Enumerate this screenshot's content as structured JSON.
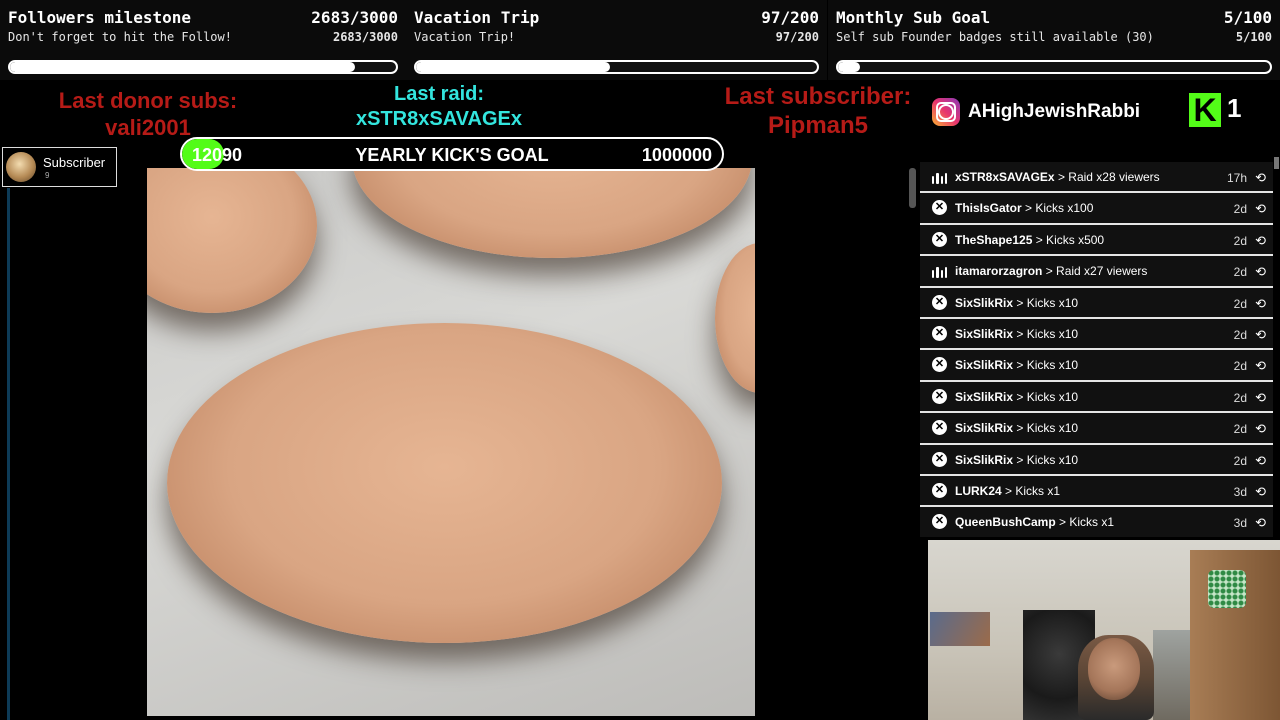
{
  "goals": [
    {
      "title": "Followers milestone",
      "count": "2683/3000",
      "subtitle": "Don't forget to hit the Follow!",
      "subcount": "2683/3000",
      "progress": 0.894
    },
    {
      "title": "Vacation Trip",
      "count": "97/200",
      "subtitle": "Vacation Trip!",
      "subcount": "97/200",
      "progress": 0.485
    },
    {
      "title": "Monthly Sub Goal",
      "count": "5/100",
      "subtitle": "Self sub Founder badges still available (30)",
      "subcount": "5/100",
      "progress": 0.05
    }
  ],
  "alerts": {
    "last_donor_label": "Last donor subs:",
    "last_donor_name": "vali2001",
    "last_raid_label": "Last raid:",
    "last_raid_name": "xSTR8xSAVAGEx",
    "last_sub_label": "Last subscriber:",
    "last_sub_name": "Pipman5"
  },
  "kick_goal": {
    "current": "12090",
    "title": "YEARLY KICK'S GOAL",
    "target": "1000000",
    "progress": 0.012
  },
  "subscriber_badge": {
    "label": "Subscriber",
    "count": "9"
  },
  "social": {
    "instagram_icon": "instagram-icon",
    "instagram_handle": "AHighJewishRabbi",
    "kick_icon": "kick-logo-icon",
    "kick_letter": "K",
    "kick_count": "1"
  },
  "events": [
    {
      "type": "raid",
      "user": "xSTR8xSAVAGEx",
      "action": "> Raid x28 viewers",
      "ago": "17h"
    },
    {
      "type": "kick",
      "user": "ThisIsGator",
      "action": "> Kicks x100",
      "ago": "2d"
    },
    {
      "type": "kick",
      "user": "TheShape125",
      "action": "> Kicks x500",
      "ago": "2d"
    },
    {
      "type": "raid",
      "user": "itamarorzagron",
      "action": "> Raid x27 viewers",
      "ago": "2d"
    },
    {
      "type": "kick",
      "user": "SixSlikRix",
      "action": "> Kicks x10",
      "ago": "2d"
    },
    {
      "type": "kick",
      "user": "SixSlikRix",
      "action": "> Kicks x10",
      "ago": "2d"
    },
    {
      "type": "kick",
      "user": "SixSlikRix",
      "action": "> Kicks x10",
      "ago": "2d"
    },
    {
      "type": "kick",
      "user": "SixSlikRix",
      "action": "> Kicks x10",
      "ago": "2d"
    },
    {
      "type": "kick",
      "user": "SixSlikRix",
      "action": "> Kicks x10",
      "ago": "2d"
    },
    {
      "type": "kick",
      "user": "SixSlikRix",
      "action": "> Kicks x10",
      "ago": "2d"
    },
    {
      "type": "kick",
      "user": "LURK24",
      "action": "> Kicks x1",
      "ago": "3d"
    },
    {
      "type": "kick",
      "user": "QueenBushCamp",
      "action": "> Kicks x1",
      "ago": "3d"
    }
  ],
  "icons": {
    "kick_event": "kick-x-icon",
    "raid_event": "raid-bars-icon",
    "replay": "replay-icon"
  },
  "colors": {
    "alert_red": "#b61b17",
    "alert_cyan": "#33e5de",
    "kick_green": "#53fc18"
  }
}
